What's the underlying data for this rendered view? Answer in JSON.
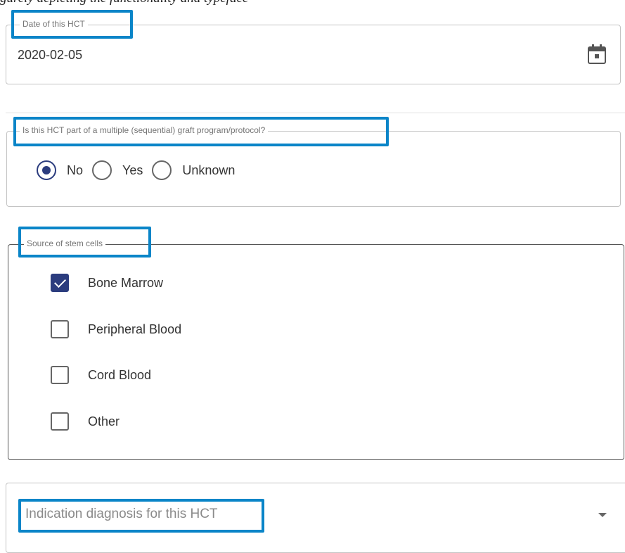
{
  "top_text": "gurely depicting the functionality and typeface",
  "date_field": {
    "legend": "Date of this HCT",
    "value": "2020-02-05",
    "icon": "calendar-icon"
  },
  "sequential_question": {
    "legend": "Is this HCT part of a multiple (sequential) graft program/protocol?",
    "options": [
      {
        "label": "No",
        "selected": true
      },
      {
        "label": "Yes",
        "selected": false
      },
      {
        "label": "Unknown",
        "selected": false
      }
    ]
  },
  "stem_cells": {
    "legend": "Source of stem cells",
    "options": [
      {
        "label": "Bone Marrow",
        "checked": true
      },
      {
        "label": "Peripheral Blood",
        "checked": false
      },
      {
        "label": "Cord Blood",
        "checked": false
      },
      {
        "label": "Other",
        "checked": false
      }
    ]
  },
  "diagnosis_select": {
    "placeholder": "Indication diagnosis for this HCT",
    "icon": "dropdown-arrow-icon"
  },
  "colors": {
    "accent": "#2b3c7e",
    "highlight": "#0a85c8",
    "border": "#c4c4c4"
  }
}
